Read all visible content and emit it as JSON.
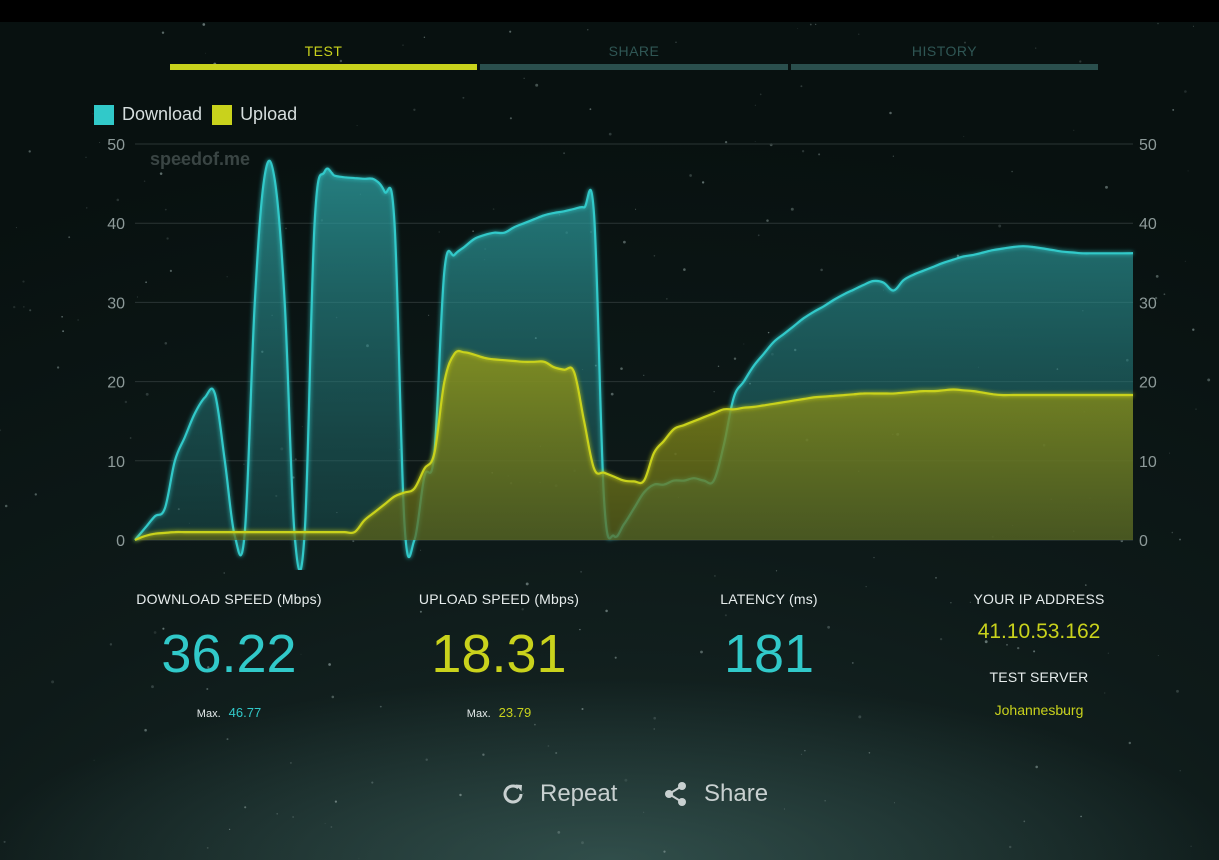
{
  "tabs": [
    {
      "label": "TEST",
      "active": true
    },
    {
      "label": "SHARE",
      "active": false
    },
    {
      "label": "HISTORY",
      "active": false
    }
  ],
  "legend": {
    "download": "Download",
    "upload": "Upload"
  },
  "watermark": "speedof.me",
  "colors": {
    "download": "#31c9c9",
    "upload": "#c9d21c",
    "accent": "#c9d21c"
  },
  "chart_data": {
    "type": "area",
    "title": "",
    "xlabel": "",
    "ylabel": "",
    "ylim": [
      0,
      50
    ],
    "yticks": [
      0,
      10,
      20,
      30,
      40,
      50
    ],
    "grid": true,
    "legend_position": "top-left",
    "x": [
      0,
      1,
      2,
      3,
      4,
      5,
      6,
      7,
      8,
      9,
      10,
      11,
      12,
      13,
      14,
      15,
      16,
      17,
      18,
      19,
      20,
      21,
      22,
      23,
      24,
      25,
      26,
      27,
      28,
      29,
      30,
      31,
      32,
      33,
      34,
      35,
      36,
      37,
      38,
      39,
      40,
      41,
      42,
      43,
      44,
      45,
      46,
      47,
      48,
      49,
      50,
      51,
      52,
      53,
      54,
      55,
      56,
      57,
      58,
      59,
      60,
      61,
      62,
      63,
      64,
      65,
      66,
      67,
      68,
      69,
      70,
      71,
      72,
      73,
      74,
      75,
      76,
      77,
      78,
      79,
      80,
      81,
      82,
      83,
      84,
      85,
      86,
      87,
      88,
      89,
      90,
      91,
      92,
      93,
      94,
      95,
      96,
      97,
      98,
      99,
      100
    ],
    "series": [
      {
        "name": "Download",
        "values": [
          0,
          1.5,
          3,
          4,
          10,
          13,
          16,
          18,
          18.5,
          10,
          0.5,
          1,
          30,
          46,
          45.5,
          30,
          0.5,
          1,
          40,
          46.5,
          46,
          45.8,
          45.7,
          45.6,
          45.5,
          44,
          40,
          2,
          0,
          8,
          11,
          34,
          36,
          37,
          38,
          38.5,
          38.8,
          38.8,
          39.5,
          40,
          40.5,
          41,
          41.3,
          41.5,
          41.8,
          42,
          41,
          5,
          0.5,
          2,
          4,
          6,
          7,
          7,
          7.5,
          7.5,
          7.8,
          7.5,
          7.5,
          12,
          18,
          20,
          22,
          23.5,
          25,
          26,
          27,
          28,
          28.8,
          29.5,
          30.3,
          31,
          31.6,
          32.2,
          32.7,
          32.5,
          31.5,
          32.8,
          33.5,
          34,
          34.5,
          35,
          35.4,
          35.8,
          36,
          36.3,
          36.6,
          36.8,
          37,
          37.1,
          37,
          36.8,
          36.6,
          36.4,
          36.3,
          36.2,
          36.2,
          36.2,
          36.2,
          36.2,
          36.22
        ]
      },
      {
        "name": "Upload",
        "values": [
          0,
          0.5,
          0.8,
          0.9,
          1,
          1,
          1,
          1,
          1,
          1,
          1,
          1,
          1,
          1,
          1,
          1,
          1,
          1,
          1,
          1,
          1,
          1,
          1,
          2.5,
          3.5,
          4.5,
          5.5,
          6,
          6.5,
          9,
          11,
          20,
          23.5,
          23.7,
          23.4,
          23,
          22.8,
          22.7,
          22.6,
          22.5,
          22.5,
          22.5,
          21.8,
          21.5,
          21.2,
          15,
          9,
          8.5,
          8,
          7.5,
          7.4,
          7.5,
          11,
          12.5,
          14,
          14.5,
          15,
          15.5,
          16,
          16.5,
          16.5,
          16.7,
          16.8,
          17,
          17.2,
          17.4,
          17.6,
          17.8,
          18,
          18.1,
          18.2,
          18.3,
          18.4,
          18.5,
          18.5,
          18.5,
          18.5,
          18.6,
          18.7,
          18.8,
          18.8,
          18.9,
          19,
          18.9,
          18.8,
          18.6,
          18.4,
          18.3,
          18.31,
          18.31,
          18.31,
          18.31,
          18.31,
          18.31,
          18.31,
          18.31,
          18.31,
          18.31,
          18.31,
          18.31,
          18.31
        ]
      }
    ]
  },
  "stats": {
    "download": {
      "label": "DOWNLOAD SPEED (Mbps)",
      "value": "36.22",
      "max_label": "Max.",
      "max_value": "46.77"
    },
    "upload": {
      "label": "UPLOAD SPEED (Mbps)",
      "value": "18.31",
      "max_label": "Max.",
      "max_value": "23.79"
    },
    "latency": {
      "label": "LATENCY (ms)",
      "value": "181"
    },
    "ip": {
      "label": "YOUR IP ADDRESS",
      "value": "41.10.53.162"
    },
    "server": {
      "label": "TEST SERVER",
      "value": "Johannesburg"
    }
  },
  "actions": {
    "repeat": {
      "label": "Repeat",
      "icon": "refresh-icon"
    },
    "share": {
      "label": "Share",
      "icon": "share-icon"
    }
  }
}
